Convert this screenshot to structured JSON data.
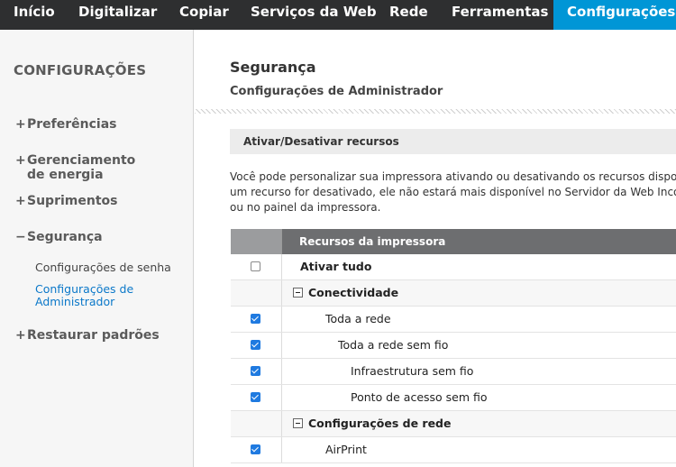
{
  "nav": {
    "tabs": [
      {
        "label": "Início"
      },
      {
        "label": "Digitalizar"
      },
      {
        "label": "Copiar"
      },
      {
        "label": "Serviços da Web"
      },
      {
        "label": "Rede"
      },
      {
        "label": "Ferramentas"
      },
      {
        "label": "Configurações",
        "active": true
      }
    ]
  },
  "sidebar": {
    "title": "CONFIGURAÇÕES",
    "items": [
      {
        "sign": "+",
        "label": "Preferências"
      },
      {
        "sign": "+",
        "label": "Gerenciamento de energia"
      },
      {
        "sign": "+",
        "label": "Suprimentos"
      },
      {
        "sign": "−",
        "label": "Segurança"
      },
      {
        "sign": "+",
        "label": "Restaurar padrões"
      }
    ],
    "subitems": [
      {
        "label": "Configurações de senha"
      },
      {
        "label": "Configurações de Administrador",
        "active": true
      }
    ]
  },
  "main": {
    "title": "Segurança",
    "subtitle": "Configurações de Administrador",
    "section_title": "Ativar/Desativar recursos",
    "description": "Você pode personalizar sua impressora ativando ou desativando os recursos disponíveis. Se um recurso for desativado, ele não estará mais disponível no Servidor da Web Incorporado ou no painel da impressora."
  },
  "table": {
    "header": "Recursos da impressora",
    "rows": [
      {
        "label": "Ativar tudo",
        "checked": false,
        "bold": true
      },
      {
        "label": "Conectividade",
        "group": true
      },
      {
        "label": "Toda a rede",
        "checked": true
      },
      {
        "label": "Toda a rede sem fio",
        "checked": true
      },
      {
        "label": "Infraestrutura sem fio",
        "checked": true
      },
      {
        "label": "Ponto de acesso sem fio",
        "checked": true
      },
      {
        "label": "Configurações de rede",
        "group": true
      },
      {
        "label": "AirPrint",
        "checked": true
      }
    ]
  },
  "colors": {
    "nav_bg": "#2e2f30",
    "active_tab": "#0096d6",
    "link": "#0b78c9",
    "checkbox": "#1f7ae0"
  }
}
